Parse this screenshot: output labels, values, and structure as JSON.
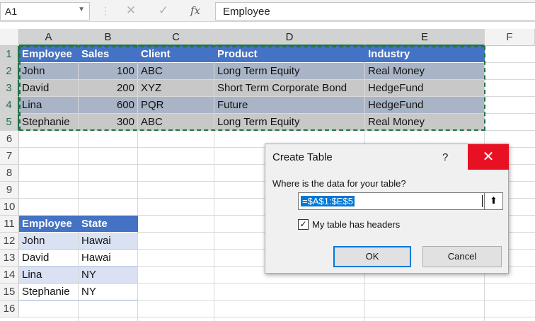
{
  "formula_bar": {
    "name_box": "A1",
    "cancel_glyph": "✕",
    "enter_glyph": "✓",
    "fx_label": "fx",
    "formula": "Employee"
  },
  "columns": [
    "A",
    "B",
    "C",
    "D",
    "E",
    "F"
  ],
  "rows": [
    "1",
    "2",
    "3",
    "4",
    "5",
    "6",
    "7",
    "8",
    "9",
    "10",
    "11",
    "12",
    "13",
    "14",
    "15",
    "16"
  ],
  "table1": {
    "headers": [
      "Employee",
      "Sales",
      "Client",
      "Product",
      "Industry"
    ],
    "rows": [
      [
        "John",
        "100",
        "ABC",
        "Long Term Equity",
        "Real Money"
      ],
      [
        "David",
        "200",
        "XYZ",
        "Short Term Corporate Bond",
        "HedgeFund"
      ],
      [
        "Lina",
        "600",
        "PQR",
        "Future",
        "HedgeFund"
      ],
      [
        "Stephanie",
        "300",
        "ABC",
        "Long Term Equity",
        "Real Money"
      ]
    ]
  },
  "table2": {
    "headers": [
      "Employee",
      "State"
    ],
    "rows": [
      [
        "John",
        "Hawai"
      ],
      [
        "David",
        "Hawai"
      ],
      [
        "Lina",
        "NY"
      ],
      [
        "Stephanie",
        "NY"
      ]
    ]
  },
  "dialog": {
    "title": "Create Table",
    "help": "?",
    "close": "✕",
    "prompt": "Where is the data for your table?",
    "range": "=$A$1:$E$5",
    "collapse_glyph": "⬆",
    "checkbox_checked": true,
    "checkbox_glyph": "✓",
    "checkbox_label": "My table has headers",
    "ok": "OK",
    "cancel": "Cancel"
  },
  "colors": {
    "header_blue": "#4472c4",
    "band_blue": "#d9e1f2",
    "selection_green": "#217346",
    "close_red": "#e81123"
  }
}
